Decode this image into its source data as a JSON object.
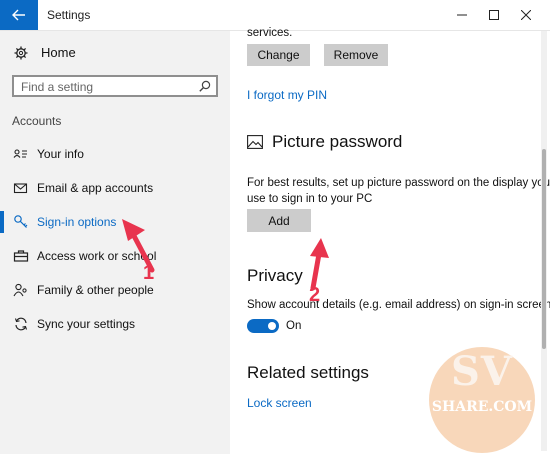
{
  "window": {
    "title": "Settings"
  },
  "sidebar": {
    "home_label": "Home",
    "search_placeholder": "Find a setting",
    "section_label": "Accounts",
    "items": [
      {
        "label": "Your info",
        "icon": "person-card-icon"
      },
      {
        "label": "Email & app accounts",
        "icon": "mail-icon"
      },
      {
        "label": "Sign-in options",
        "icon": "key-icon",
        "selected": true
      },
      {
        "label": "Access work or school",
        "icon": "briefcase-icon"
      },
      {
        "label": "Family & other people",
        "icon": "people-icon"
      },
      {
        "label": "Sync your settings",
        "icon": "sync-icon"
      }
    ]
  },
  "main": {
    "services_text": "services.",
    "change_label": "Change",
    "remove_label": "Remove",
    "forgot_pin_link": "I forgot my PIN",
    "picture_password_heading": "Picture password",
    "picture_password_desc_1": "For best results, set up picture password on the display you",
    "picture_password_desc_2": "use to sign in to your PC",
    "add_label": "Add",
    "privacy_heading": "Privacy",
    "privacy_desc": "Show account details (e.g. email address) on sign-in screen",
    "toggle_state": "On",
    "related_heading": "Related settings",
    "lock_screen_link": "Lock screen"
  },
  "annotations": {
    "marker_1": "1",
    "marker_2": "2"
  },
  "watermark": {
    "line1": "SV",
    "line2": "SHARE.COM"
  },
  "colors": {
    "accent": "#0b6ac4",
    "arrow": "#e8344e",
    "watermark": "#f6c9a3"
  }
}
